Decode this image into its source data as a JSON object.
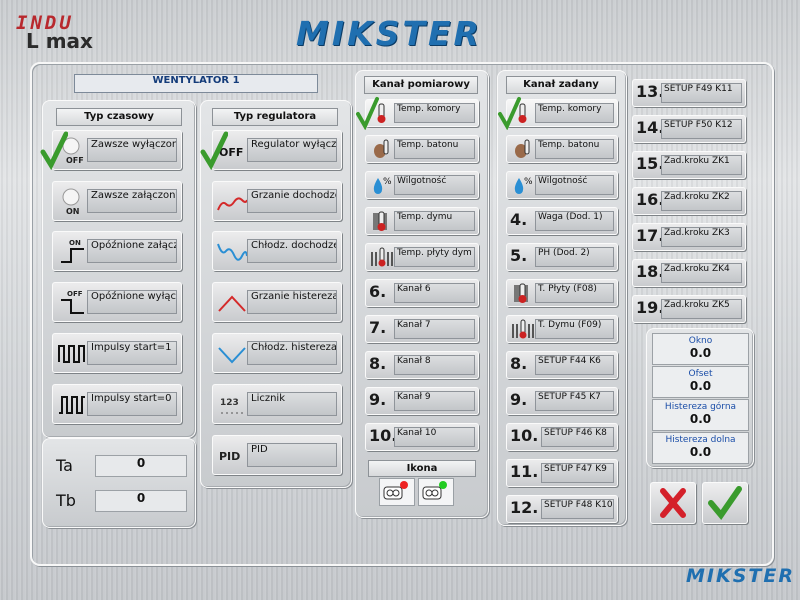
{
  "brand": {
    "indu_line1": "INDU",
    "indu_line2": "L max",
    "main": "MIKSTER",
    "footer": "MIKSTER"
  },
  "colors": {
    "brand_blue": "#1f6fb0",
    "indu_red": "#b8282d",
    "check_green": "#3a9b2d",
    "cancel_red": "#d4202a"
  },
  "title": "WENTYLATOR 1",
  "typ_czasowy": {
    "title": "Typ czasowy",
    "items": [
      {
        "label": "Zawsze wyłączony",
        "icon": "off-knob-icon",
        "badge": "OFF",
        "selected": true
      },
      {
        "label": "Zawsze załączony",
        "icon": "on-knob-icon",
        "badge": "ON"
      },
      {
        "label": "Opóźnione załączer",
        "icon": "delayed-on-icon",
        "badge": "ON"
      },
      {
        "label": "Opóźnione wyłącze",
        "icon": "delayed-off-icon",
        "badge": "OFF"
      },
      {
        "label": "Impulsy start=1",
        "icon": "pulse-start1-icon"
      },
      {
        "label": "Impulsy start=0",
        "icon": "pulse-start0-icon"
      }
    ]
  },
  "typ_regulatora": {
    "title": "Typ regulatora",
    "items": [
      {
        "label": "Regulator wyłączor",
        "icon": "off-text-icon",
        "badge": "OFF",
        "selected": true
      },
      {
        "label": "Grzanie dochodzen",
        "icon": "heating-approach-icon"
      },
      {
        "label": "Chłodz. dochodzen",
        "icon": "cooling-approach-icon"
      },
      {
        "label": "Grzanie histereza",
        "icon": "heating-hysteresis-icon"
      },
      {
        "label": "Chłodz. histereza",
        "icon": "cooling-hysteresis-icon"
      },
      {
        "label": "Licznik",
        "icon": "counter-icon",
        "badge": "123"
      },
      {
        "label": "PID",
        "icon": "pid-icon",
        "badge": "PID"
      }
    ]
  },
  "ta_tb": [
    {
      "label": "Ta",
      "value": "0"
    },
    {
      "label": "Tb",
      "value": "0"
    }
  ],
  "kanal_pomiarowy": {
    "title": "Kanał pomiarowy",
    "items": [
      {
        "label": "Temp. komory",
        "icon": "thermometer-icon",
        "selected": true
      },
      {
        "label": "Temp. batonu",
        "icon": "thermometer-probe-icon"
      },
      {
        "label": "Wilgotność",
        "icon": "humidity-icon"
      },
      {
        "label": "Temp. dymu",
        "icon": "smoke-thermometer-icon"
      },
      {
        "label": "Temp. płyty dym",
        "icon": "plate-thermometer-icon"
      },
      {
        "num": "6.",
        "label": "Kanał 6"
      },
      {
        "num": "7.",
        "label": "Kanał 7"
      },
      {
        "num": "8.",
        "label": "Kanał 8"
      },
      {
        "num": "9.",
        "label": "Kanał 9"
      },
      {
        "num": "10.",
        "label": "Kanał 10"
      }
    ]
  },
  "ikona": {
    "title": "Ikona"
  },
  "kanal_zadany": {
    "title": "Kanał zadany",
    "items": [
      {
        "label": "Temp. komory",
        "icon": "thermometer-icon",
        "selected": true
      },
      {
        "label": "Temp. batonu",
        "icon": "thermometer-probe-icon"
      },
      {
        "label": "Wilgotność",
        "icon": "humidity-icon"
      },
      {
        "num": "4.",
        "label": "Waga (Dod. 1)"
      },
      {
        "num": "5.",
        "label": "PH (Dod. 2)"
      },
      {
        "label": "T. Płyty (F08)",
        "icon": "plate-thermometer-icon"
      },
      {
        "label": "T. Dymu (F09)",
        "icon": "smoke-thermometer-icon"
      },
      {
        "num": "8.",
        "label": "SETUP F44 K6"
      },
      {
        "num": "9.",
        "label": "SETUP F45 K7"
      },
      {
        "num": "10.",
        "label": "SETUP F46 K8"
      },
      {
        "num": "11.",
        "label": "SETUP F47 K9"
      },
      {
        "num": "12.",
        "label": "SETUP F48 K10"
      }
    ]
  },
  "kanal_zadany_more": [
    {
      "num": "13.",
      "label": "SETUP F49 K11"
    },
    {
      "num": "14.",
      "label": "SETUP F50 K12"
    },
    {
      "num": "15.",
      "label": "Zad.kroku ZK1"
    },
    {
      "num": "16.",
      "label": "Zad.kroku ZK2"
    },
    {
      "num": "17.",
      "label": "Zad.kroku ZK3"
    },
    {
      "num": "18.",
      "label": "Zad.kroku ZK4"
    },
    {
      "num": "19.",
      "label": "Zad.kroku ZK5"
    }
  ],
  "params": [
    {
      "label": "Okno",
      "value": "0.0"
    },
    {
      "label": "Ofset",
      "value": "0.0"
    },
    {
      "label": "Histereza górna",
      "value": "0.0"
    },
    {
      "label": "Histereza dolna",
      "value": "0.0"
    }
  ]
}
